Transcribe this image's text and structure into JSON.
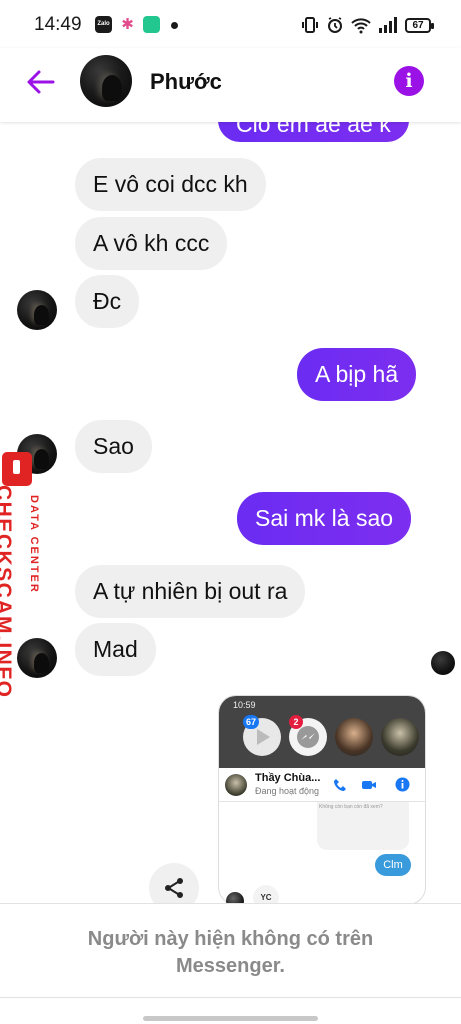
{
  "status_bar": {
    "time": "14:49",
    "app_zalo_label": "Zalo",
    "battery": "67"
  },
  "header": {
    "contact_name": "Phước",
    "accent_color": "#9b12e6"
  },
  "messages": [
    {
      "id": "out-partial",
      "direction": "outgoing",
      "text": "Cio em ae ae k"
    },
    {
      "id": "in-1",
      "direction": "incoming",
      "text": "E vô coi dcc kh"
    },
    {
      "id": "in-2",
      "direction": "incoming",
      "text": "A vô kh ccc"
    },
    {
      "id": "in-3",
      "direction": "incoming",
      "text": "Đc"
    },
    {
      "id": "out-1",
      "direction": "outgoing",
      "text": "A bịp hã"
    },
    {
      "id": "in-4",
      "direction": "incoming",
      "text": "Sao"
    },
    {
      "id": "out-2",
      "direction": "outgoing",
      "text": "Sai mk là sao"
    },
    {
      "id": "in-5",
      "direction": "incoming",
      "text": "A tự nhiên bị out ra"
    },
    {
      "id": "in-6",
      "direction": "incoming",
      "text": "Mad"
    }
  ],
  "shared_screenshot": {
    "time": "10:59",
    "badge_video": "67",
    "badge_messenger": "2",
    "contact_name": "Thầy Chùa...",
    "contact_status": "Đang hoạt động",
    "panel_text": "Không còn bạn còn đã xem?",
    "reply_text": "Clm"
  },
  "reaction_label": "YC",
  "watermark": {
    "main": "CHECKSCAM.INFO",
    "sub": "DATA CENTER"
  },
  "footer": {
    "notice": "Người này hiện không có trên Messenger."
  },
  "colors": {
    "outgoing_bubble": "#7b2df1",
    "incoming_bubble": "#efefef",
    "watermark_red": "#e02424"
  }
}
